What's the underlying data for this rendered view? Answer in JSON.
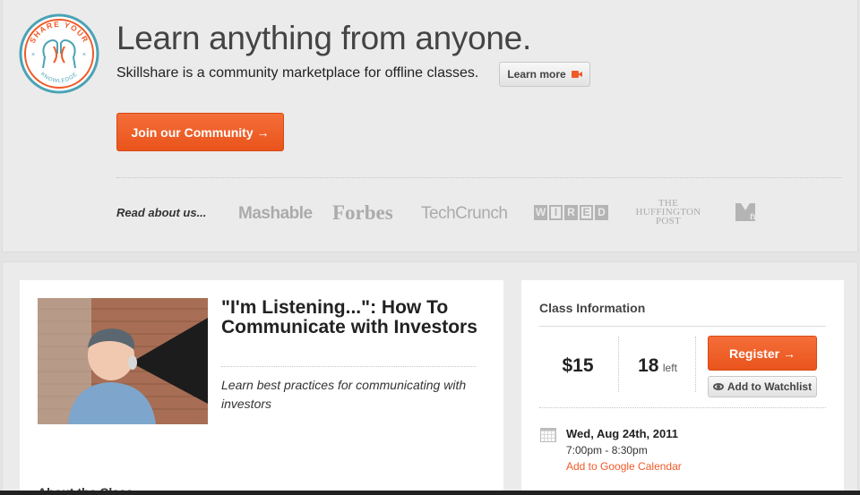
{
  "hero": {
    "logo_text_top": "SHARE YOUR",
    "logo_text_bottom": "KNOWLEDGE",
    "headline": "Learn anything from anyone.",
    "tagline": "Skillshare is a community marketplace for offline classes.",
    "learn_more_label": "Learn more",
    "join_label": "Join our Community →",
    "colors": {
      "accent": "#f05a28",
      "logo_blue": "#4aa3b5"
    }
  },
  "press": {
    "label": "Read about us...",
    "logos": {
      "mashable": "Mashable",
      "forbes": "Forbes",
      "techcrunch": "TechCrunch",
      "wired": "WIRED",
      "huffington": [
        "THE",
        "HUFFINGTON",
        "POST"
      ],
      "mtv": "MTV"
    }
  },
  "class": {
    "title": "\"I'm Listening...\": How To Communicate with Investors",
    "description": "Learn best practices for communicating with investors",
    "about_heading": "About the Class"
  },
  "info": {
    "heading": "Class Information",
    "price": "$15",
    "spots_count": "18",
    "spots_label": "left",
    "register_label": "Register →",
    "watchlist_label": "Add to Watchlist",
    "date": "Wed, Aug 24th, 2011",
    "time": "7:00pm - 8:30pm",
    "calendar_link": "Add to Google Calendar"
  }
}
